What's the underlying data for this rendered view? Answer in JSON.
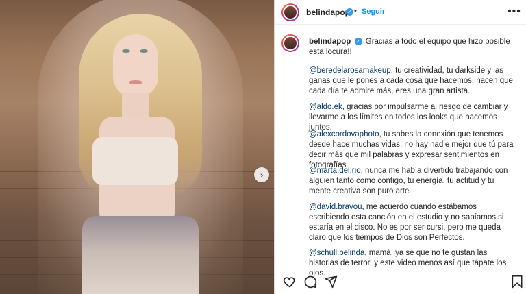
{
  "post": {
    "username": "belindapop",
    "follow_label": "Seguir",
    "separator": "•",
    "more_label": "•••",
    "image_alt": "photo",
    "next_arrow": "›"
  },
  "caption": {
    "first_line": "Gracias a todo el equipo que hizo posible esta locura!!",
    "paragraphs": [
      {
        "mention": "@beredelarosamakeup",
        "text": ", tu creatividad, tu darkside y las ganas que le pones a cada cosa que hacemos, hacen que cada día te admire más, eres una gran artista."
      },
      {
        "mention": "@aldo.ek",
        "text": ", gracias por impulsarme al riesgo de cambiar y llevarme a los límites en todos los looks que hacemos juntos."
      },
      {
        "mention": "@alexcordovaphoto",
        "text": ", tu sabes la conexión que tenemos desde hace muchas vidas, no hay nadie mejor que tú para decir más que mil palabras y expresar sentimientos en fotografías."
      },
      {
        "mention": "@marta.del.rio",
        "text": ", nunca me había divertido trabajando con alguien tanto como contigo, tu energía, tu actitud y tu mente creativa son puro arte."
      },
      {
        "mention": "@david.bravou",
        "text": ", me acuerdo cuando estábamos escribiendo esta canción en el estudio y no sabíamos si estaría en el disco. No es por ser cursi, pero me queda claro que los tiempos de Dios son Perfectos."
      },
      {
        "mention": "@schull.belinda",
        "text": ", mamá, ya se que no te gustan las historias de terror, y este video menos así que tápate los ojos."
      }
    ]
  },
  "actions": {
    "like": "heart-icon",
    "comment": "comment-icon",
    "share": "share-icon",
    "save": "bookmark-icon"
  },
  "colors": {
    "link": "#00376b",
    "follow": "#0095f6",
    "verified": "#3897f0"
  }
}
